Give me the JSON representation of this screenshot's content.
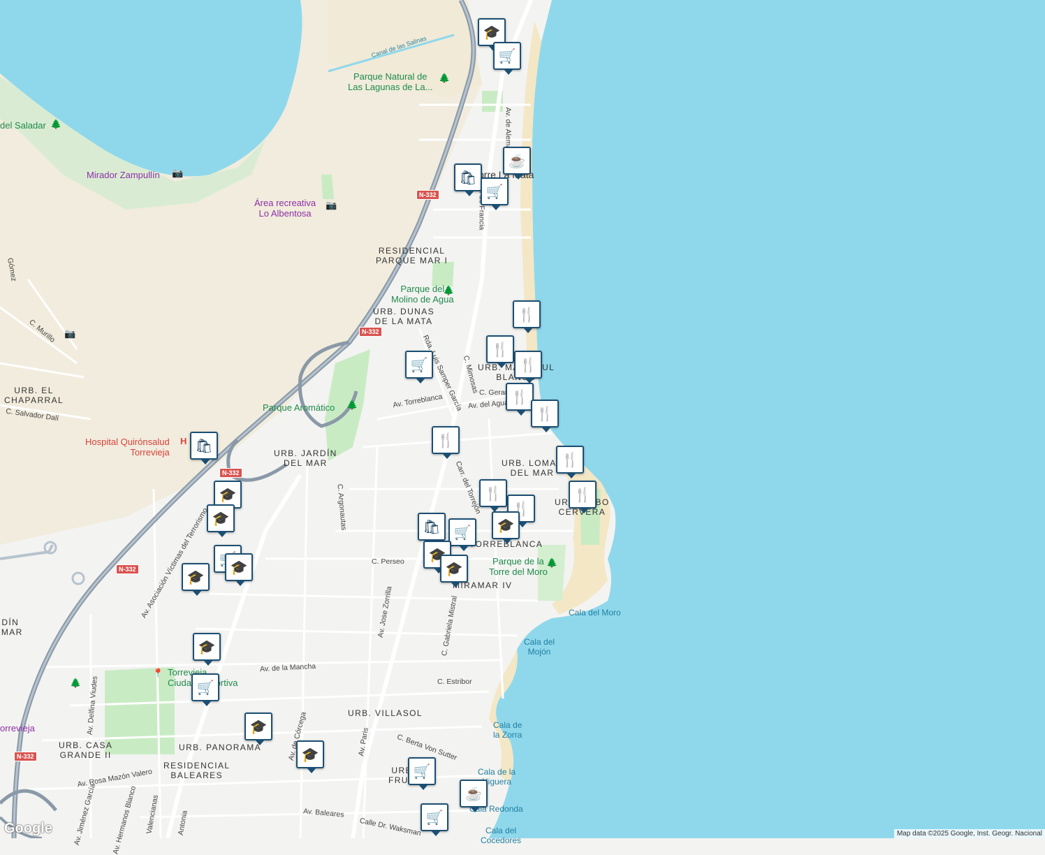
{
  "map": {
    "attribution": "Map data ©2025 Google, Inst. Geogr. Nacional",
    "logo": "Google",
    "colors": {
      "sea": "#8fd8ec",
      "land": "#f3f3f1",
      "wetland": "#f1ecdd",
      "park": "#c9ebc4",
      "highway": "#8a99a8",
      "beach": "#f3e7c6"
    },
    "parks": [
      {
        "id": "parque-natural",
        "text": "Parque Natural de\nLas Lagunas de La..."
      },
      {
        "id": "saladar",
        "text": "del Saladar"
      },
      {
        "id": "molino",
        "text": "Parque del\nMolino de Agua"
      },
      {
        "id": "aromatico",
        "text": "Parque Aromático"
      },
      {
        "id": "torre-moro",
        "text": "Parque de la\nTorre del Moro"
      }
    ],
    "pois": [
      {
        "id": "mirador",
        "text": "Mirador Zampullín"
      },
      {
        "id": "albentosa",
        "text": "Área recreativa\nLo Albentosa"
      },
      {
        "id": "ciudad-deportiva",
        "text": "Torrevieja\nCiudad Deportiva"
      },
      {
        "id": "torrevieja-left",
        "text": "orrevieja"
      }
    ],
    "hospital": "Hospital Quirónsalud\nTorrevieja",
    "districts": [
      {
        "id": "parque-mar",
        "text": "RESIDENCIAL\nPARQUE MAR I"
      },
      {
        "id": "dunas",
        "text": "URB. DUNAS\nDE LA MATA"
      },
      {
        "id": "chaparral",
        "text": "URB. EL\nCHAPARRAL"
      },
      {
        "id": "jardin",
        "text": "URB. JARDÍN\nDEL MAR"
      },
      {
        "id": "lomas",
        "text": "URB. LOMAS\nDEL MAR"
      },
      {
        "id": "cabo",
        "text": "URB. CABO\nCERVERA"
      },
      {
        "id": "mar-azul",
        "text": "URB. MAR AZUL\nBLANCO"
      },
      {
        "id": "torreblanca",
        "text": "URB.\nTORREBLANCA"
      },
      {
        "id": "miramar",
        "text": "MIRAMAR IV"
      },
      {
        "id": "villasol",
        "text": "URB. VILLASOL"
      },
      {
        "id": "casa-grande",
        "text": "URB. CASA\nGRANDE II"
      },
      {
        "id": "panorama",
        "text": "URB. PANORAMA"
      },
      {
        "id": "baleares",
        "text": "RESIDENCIAL\nBALEARES"
      },
      {
        "id": "frutales",
        "text": "URB.\nFRU..."
      },
      {
        "id": "torre-mata",
        "text": "Torre La Mata"
      },
      {
        "id": "jardin-left",
        "text": "JARDÍN\nDEL MAR"
      }
    ],
    "streets": [
      {
        "id": "canal",
        "text": "Canal de las Salinas"
      },
      {
        "id": "av-alemania",
        "text": "Av. de Alemania"
      },
      {
        "id": "av-francia",
        "text": "Av. de Francia"
      },
      {
        "id": "murillo",
        "text": "C. Murillo"
      },
      {
        "id": "dali",
        "text": "C. Salvador Dalí"
      },
      {
        "id": "ronda",
        "text": "Rda. Luis Samper García"
      },
      {
        "id": "mimosas",
        "text": "C. Mimosas"
      },
      {
        "id": "geranios",
        "text": "C. Geranios"
      },
      {
        "id": "torreblanca-av",
        "text": "Av. Torreblanca"
      },
      {
        "id": "agua",
        "text": "Av. del Agua"
      },
      {
        "id": "argonautas",
        "text": "C. Argonautas"
      },
      {
        "id": "torrejon",
        "text": "Carr. del Torrejón"
      },
      {
        "id": "victimas",
        "text": "Av. Asociación Víctimas del Terrorismo"
      },
      {
        "id": "perseo",
        "text": "C. Perseo"
      },
      {
        "id": "zorrilla",
        "text": "Av. Jose Zorrilla"
      },
      {
        "id": "mistral",
        "text": "C. Gabriela Mistral"
      },
      {
        "id": "mancha",
        "text": "Av. de la Mancha"
      },
      {
        "id": "estribor",
        "text": "C. Estribor"
      },
      {
        "id": "viudes",
        "text": "Av. Delfina Viudes"
      },
      {
        "id": "corcega",
        "text": "Av. de Córcega"
      },
      {
        "id": "paris",
        "text": "Av. Paris"
      },
      {
        "id": "sutter",
        "text": "C. Berta Von Sutter"
      },
      {
        "id": "rosa",
        "text": "Av. Rosa Mazón Valero"
      },
      {
        "id": "jimenez",
        "text": "Av. Jiménez García"
      },
      {
        "id": "hermanos",
        "text": "Av. Hermanos Blanco"
      },
      {
        "id": "valencianas",
        "text": "Valencianas"
      },
      {
        "id": "baleares-av",
        "text": "Av. Baleares"
      },
      {
        "id": "waksman",
        "text": "Calle Dr. Waksman"
      },
      {
        "id": "antonia",
        "text": "Antonia"
      },
      {
        "id": "gomez",
        "text": "Gómez"
      }
    ],
    "water_labels": [
      {
        "id": "cala-moro",
        "text": "Cala del Moro"
      },
      {
        "id": "cala-mojon",
        "text": "Cala del\nMojón"
      },
      {
        "id": "cala-zorra",
        "text": "Cala de\nla Zorra"
      },
      {
        "id": "cala-higuera",
        "text": "Cala de la\nHiguera"
      },
      {
        "id": "cala-redonda",
        "text": "Cala Redonda"
      },
      {
        "id": "cala-cocedores",
        "text": "Cala del\nCocedores"
      }
    ],
    "road_shields": [
      "N-332",
      "N-332",
      "N-332",
      "N-332",
      "N-332"
    ]
  }
}
